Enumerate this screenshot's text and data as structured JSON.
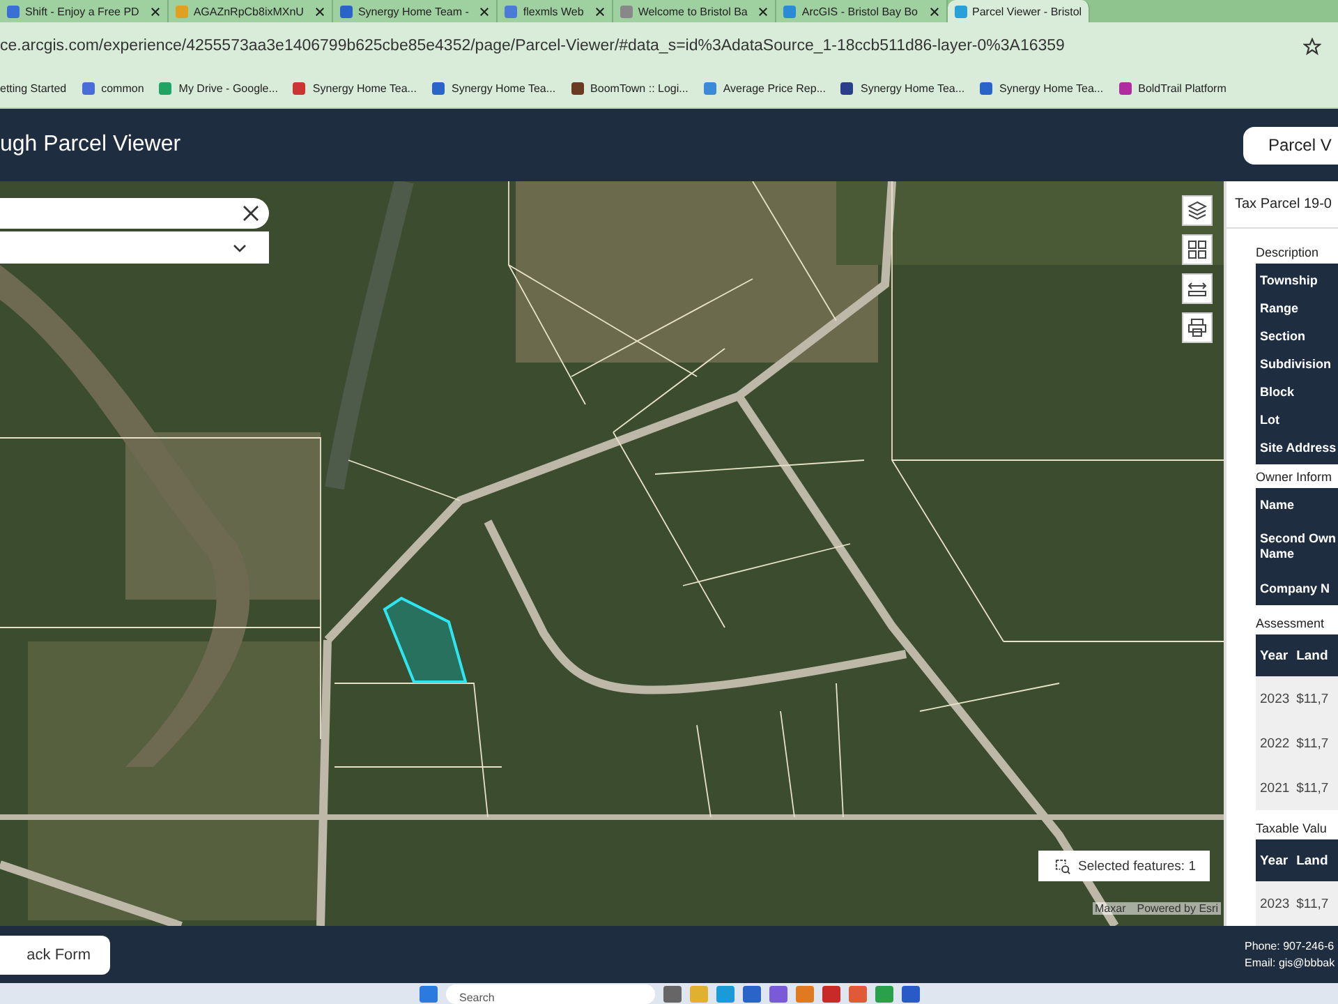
{
  "browser": {
    "tabs": [
      {
        "title": "Shift - Enjoy a Free PD",
        "selected": false
      },
      {
        "title": "AGAZnRpCb8ixMXnU",
        "selected": false
      },
      {
        "title": "Synergy Home Team -",
        "selected": false
      },
      {
        "title": "flexmls Web",
        "selected": false
      },
      {
        "title": "Welcome to Bristol Ba",
        "selected": false
      },
      {
        "title": "ArcGIS - Bristol Bay Bo",
        "selected": false
      },
      {
        "title": "Parcel Viewer - Bristol",
        "selected": true
      }
    ],
    "url": "ce.arcgis.com/experience/4255573aa3e1406799b625cbe85e4352/page/Parcel-Viewer/#data_s=id%3AdataSource_1-18ccb511d86-layer-0%3A16359",
    "bookmarks": [
      "etting Started",
      "common",
      "My Drive - Google...",
      "Synergy Home Tea...",
      "Synergy Home Tea...",
      "BoomTown :: Logi...",
      "Average Price Rep...",
      "Synergy Home Tea...",
      "Synergy Home Tea...",
      "BoldTrail Platform"
    ]
  },
  "app": {
    "title": "ugh Parcel Viewer",
    "header_button": "Parcel V"
  },
  "map": {
    "selected_features": "Selected features: 1",
    "attribution": [
      "Maxar",
      "Powered by Esri"
    ]
  },
  "panel": {
    "title": "Tax Parcel 19-0",
    "sections": [
      {
        "kind": "fields",
        "heading": "Description",
        "rows": [
          [
            "Township"
          ],
          [
            "Range"
          ],
          [
            "Section"
          ],
          [
            "Subdivision"
          ],
          [
            "Block"
          ],
          [
            "Lot"
          ],
          [
            "Site Address"
          ]
        ]
      },
      {
        "kind": "fields",
        "heading": "Owner Inform",
        "rows": [
          [
            "Name"
          ],
          [
            "Second Own",
            "Name"
          ],
          [
            "Company N"
          ]
        ]
      },
      {
        "kind": "table",
        "heading": "Assessment",
        "columns": [
          "Year",
          "Land"
        ],
        "rows": [
          [
            "2023",
            "$11,7"
          ],
          [
            "2022",
            "$11,7"
          ],
          [
            "2021",
            "$11,7"
          ]
        ]
      },
      {
        "kind": "table",
        "heading": "Taxable Valu",
        "columns": [
          "Year",
          "Land"
        ],
        "rows": [
          [
            "2023",
            "$11,7"
          ]
        ]
      }
    ]
  },
  "footer": {
    "button": "ack Form",
    "contact": [
      "Phone: 907-246-6",
      "Email: gis@bbbak"
    ]
  },
  "taskbar": {
    "search": "Search"
  }
}
